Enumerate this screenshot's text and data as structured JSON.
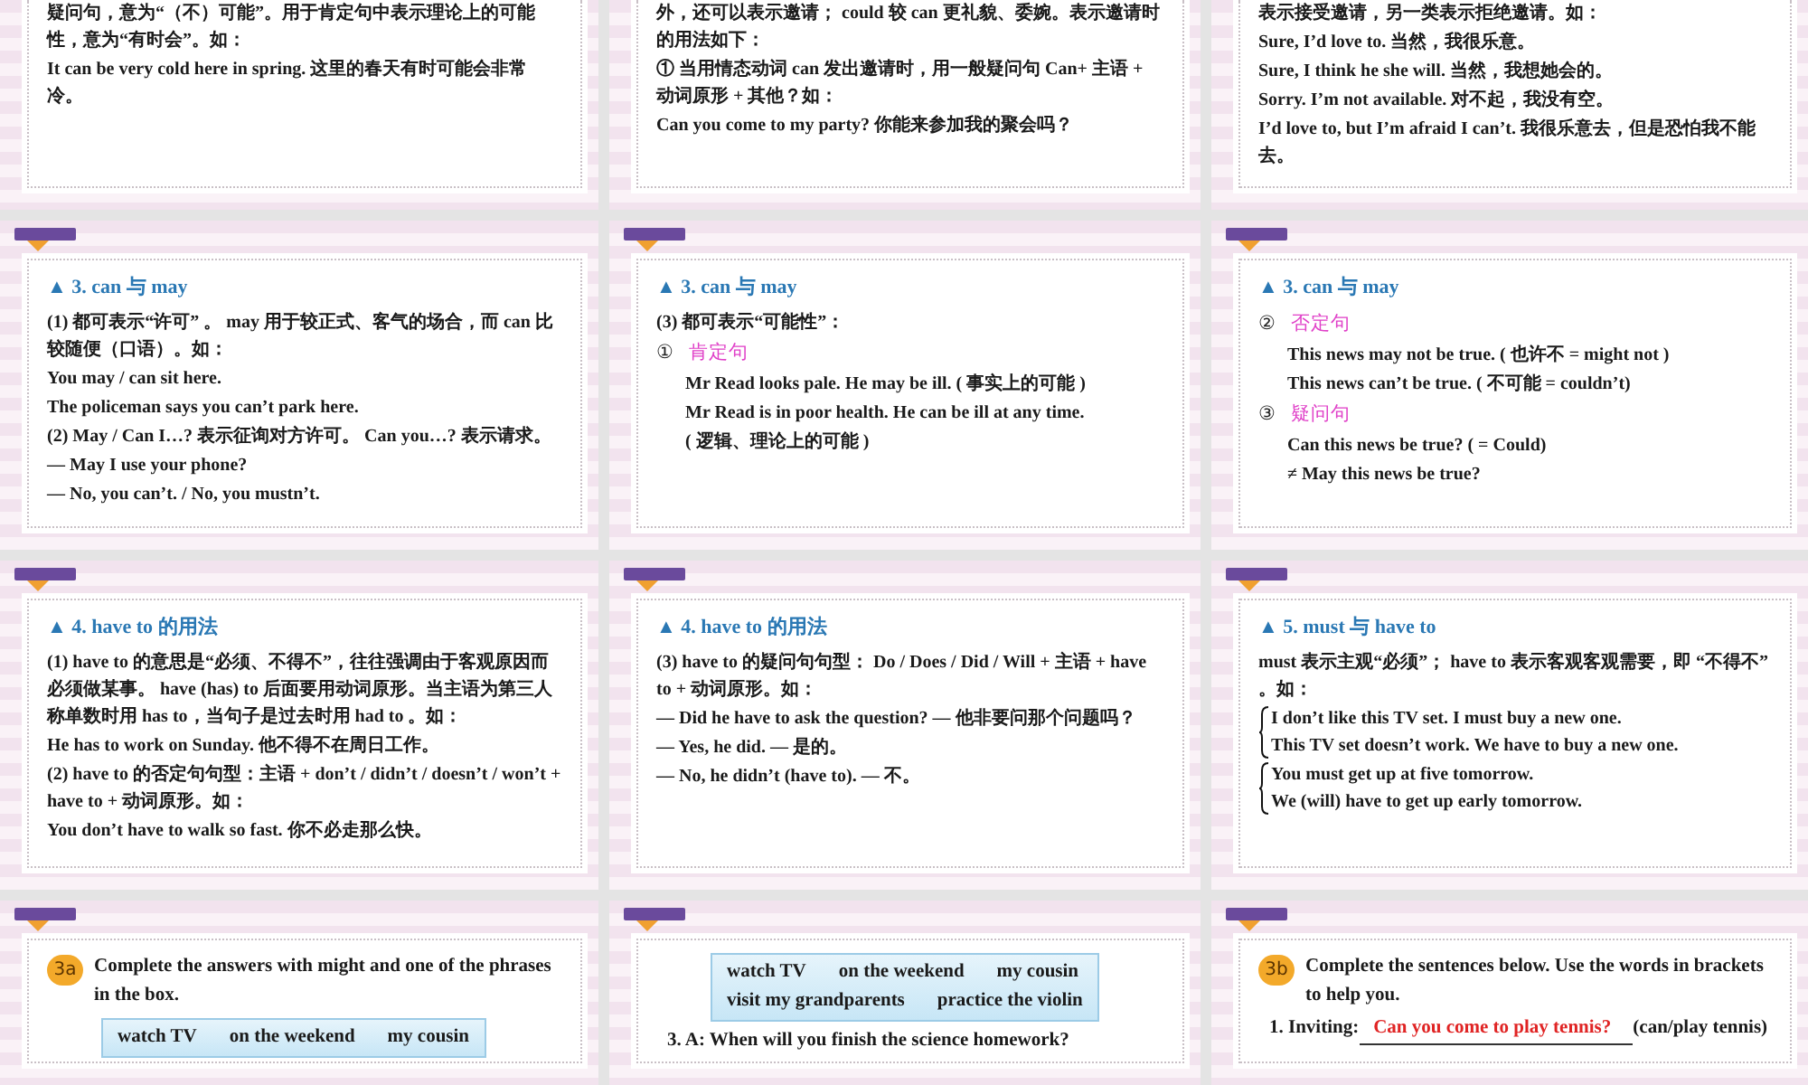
{
  "slides": [
    {
      "kind": "notes",
      "lines": [
        {
          "kind": "text",
          "text": "疑问句，意为“（不）可能”。用于肯定句中表示理论上的可能性，意为“有时会”。如："
        },
        {
          "kind": "text",
          "text": " It can be very cold here in spring.  这里的春天有时可能会非常冷。"
        }
      ]
    },
    {
      "kind": "notes",
      "lines": [
        {
          "kind": "text",
          "text": "外，还可以表示邀请； could 较 can 更礼貌、委婉。表示邀请时的用法如下："
        },
        {
          "kind": "text",
          "text": "①  当用情态动词 can 发出邀请时，用一般疑问句   Can+ 主语 + 动词原形 + 其他？如："
        },
        {
          "kind": "text",
          "text": "Can you come to my party?   你能来参加我的聚会吗？"
        }
      ]
    },
    {
      "kind": "notes",
      "lines": [
        {
          "kind": "text",
          "text": "表示**接受**邀请，另一类表示**拒绝**邀请。如："
        },
        {
          "kind": "text",
          "text": "Sure, I’d love to.  当然，我很乐意。"
        },
        {
          "kind": "text",
          "text": "Sure, I think he she will.  当然，我想她会的。"
        },
        {
          "kind": "text",
          "text": "Sorry. I’m not available.  对不起，我没有空。"
        },
        {
          "kind": "text",
          "text": "I’d love to, but I’m afraid I can’t.  我很乐意去，但是恐怕我不能去。"
        }
      ]
    },
    {
      "kind": "notes",
      "heading": "▲ 3. can  与   may",
      "lines": [
        {
          "kind": "text",
          "text": "(1)  都可表示“许可” 。 may 用于较正式、客气的场合，而 can 比较随便（口语）。如："
        },
        {
          "kind": "text",
          "text": "You may / can sit here."
        },
        {
          "kind": "text",
          "text": "The policeman says you can’t park here."
        },
        {
          "kind": "text",
          "text": "(2) May / Can I…?  表示征询对方许可。 Can you…?  表示请求。"
        },
        {
          "kind": "text",
          "text": "— May I use your phone?"
        },
        {
          "kind": "text",
          "text": "— No, you can’t. / No, you mustn’t."
        }
      ]
    },
    {
      "kind": "notes",
      "heading": "▲ 3. can  与   may",
      "lines": [
        {
          "kind": "text",
          "text": "(3)  都可表示“可能性”："
        },
        {
          "kind": "sub",
          "number": "①",
          "label": "肯定句"
        },
        {
          "kind": "indent",
          "text": "Mr Read looks pale. He may be ill. ( 事实上的可能 )"
        },
        {
          "kind": "indent",
          "text": "Mr Read is in poor health. He can be ill at any time."
        },
        {
          "kind": "indent",
          "text": "( 逻辑、理论上的可能 )"
        }
      ]
    },
    {
      "kind": "notes",
      "heading": "▲ 3. can  与   may",
      "lines": [
        {
          "kind": "sub",
          "number": "②",
          "label": "否定句"
        },
        {
          "kind": "indent",
          "text": "This news may not be true. ( 也许不   = might not )"
        },
        {
          "kind": "indent",
          "text": "This news can’t be true. ( 不可能   = couldn’t)"
        },
        {
          "kind": "sub",
          "number": "③",
          "label": "疑问句"
        },
        {
          "kind": "indent",
          "text": "Can this news be true? ( = Could)"
        },
        {
          "kind": "indent",
          "text": "≠ May this news be true?"
        }
      ]
    },
    {
      "kind": "notes",
      "heading": "▲ 4. have to  的用法",
      "lines": [
        {
          "kind": "text",
          "text": "(1) have to  的意思是“必须、不得不”，往往强调由于客观原因而必须做某事。 have (has) to  后面要用动词原形。当主语为第三人称单数时用   has to，当句子是过去时用   had to 。如："
        },
        {
          "kind": "text",
          "text": "He has to work on Sunday.  他不得不在周日工作。"
        },
        {
          "kind": "text",
          "text": "(2) have to  的否定句句型：主语   + don’t / didn’t / doesn’t / won’t + have to +  动词原形。如："
        },
        {
          "kind": "text",
          "text": "You don’t have to walk so fast.  你不必走那么快。"
        }
      ]
    },
    {
      "kind": "notes",
      "heading": "▲ 4. have to  的用法",
      "lines": [
        {
          "kind": "text",
          "text": "(3) have to  的疑问句句型：  Do / Does / Did / Will +  主语   + have to +  动词原形。如："
        },
        {
          "kind": "text",
          "text": "— Did he have to ask the question? — 他非要问那个问题吗？"
        },
        {
          "kind": "text",
          "text": "— Yes, he did. — 是的。"
        },
        {
          "kind": "text",
          "text": "— No, he didn’t (have to). — 不。"
        }
      ]
    },
    {
      "kind": "notes",
      "heading": "▲ 5. must  与   have to",
      "lines": [
        {
          "kind": "text",
          "text": "must  表示主观“必须”；  have to 表示客观客观需要，即 “不得不” 。如："
        },
        {
          "kind": "brace",
          "lines": [
            "I don’t like this TV set. I must buy a new one.",
            "This TV set doesn’t work. We have to buy a new one."
          ]
        },
        {
          "kind": "brace",
          "lines": [
            "You must get up at five tomorrow.",
            "We (will) have to get up early tomorrow."
          ]
        }
      ]
    },
    {
      "kind": "exercise",
      "badge": "3a",
      "instruction": "Complete the answers with might and one of the phrases in the box.",
      "phrase_rows": [
        [
          "watch TV",
          "on the weekend",
          "my cousin"
        ]
      ]
    },
    {
      "kind": "exercise",
      "phrase_rows": [
        [
          "watch TV",
          "on the weekend",
          "my cousin"
        ],
        [
          "visit my grandparents",
          "practice the violin"
        ]
      ],
      "items": [
        {
          "prompt": "3. A: When will you finish the science homework?"
        }
      ]
    },
    {
      "kind": "exercise",
      "badge": "3b",
      "instruction": "Complete the sentences below. Use the words in brackets to help you.",
      "items": [
        {
          "prompt": "1. Inviting:",
          "answer": "Can you come to play tennis?",
          "hint": "(can/play tennis)"
        }
      ]
    }
  ]
}
